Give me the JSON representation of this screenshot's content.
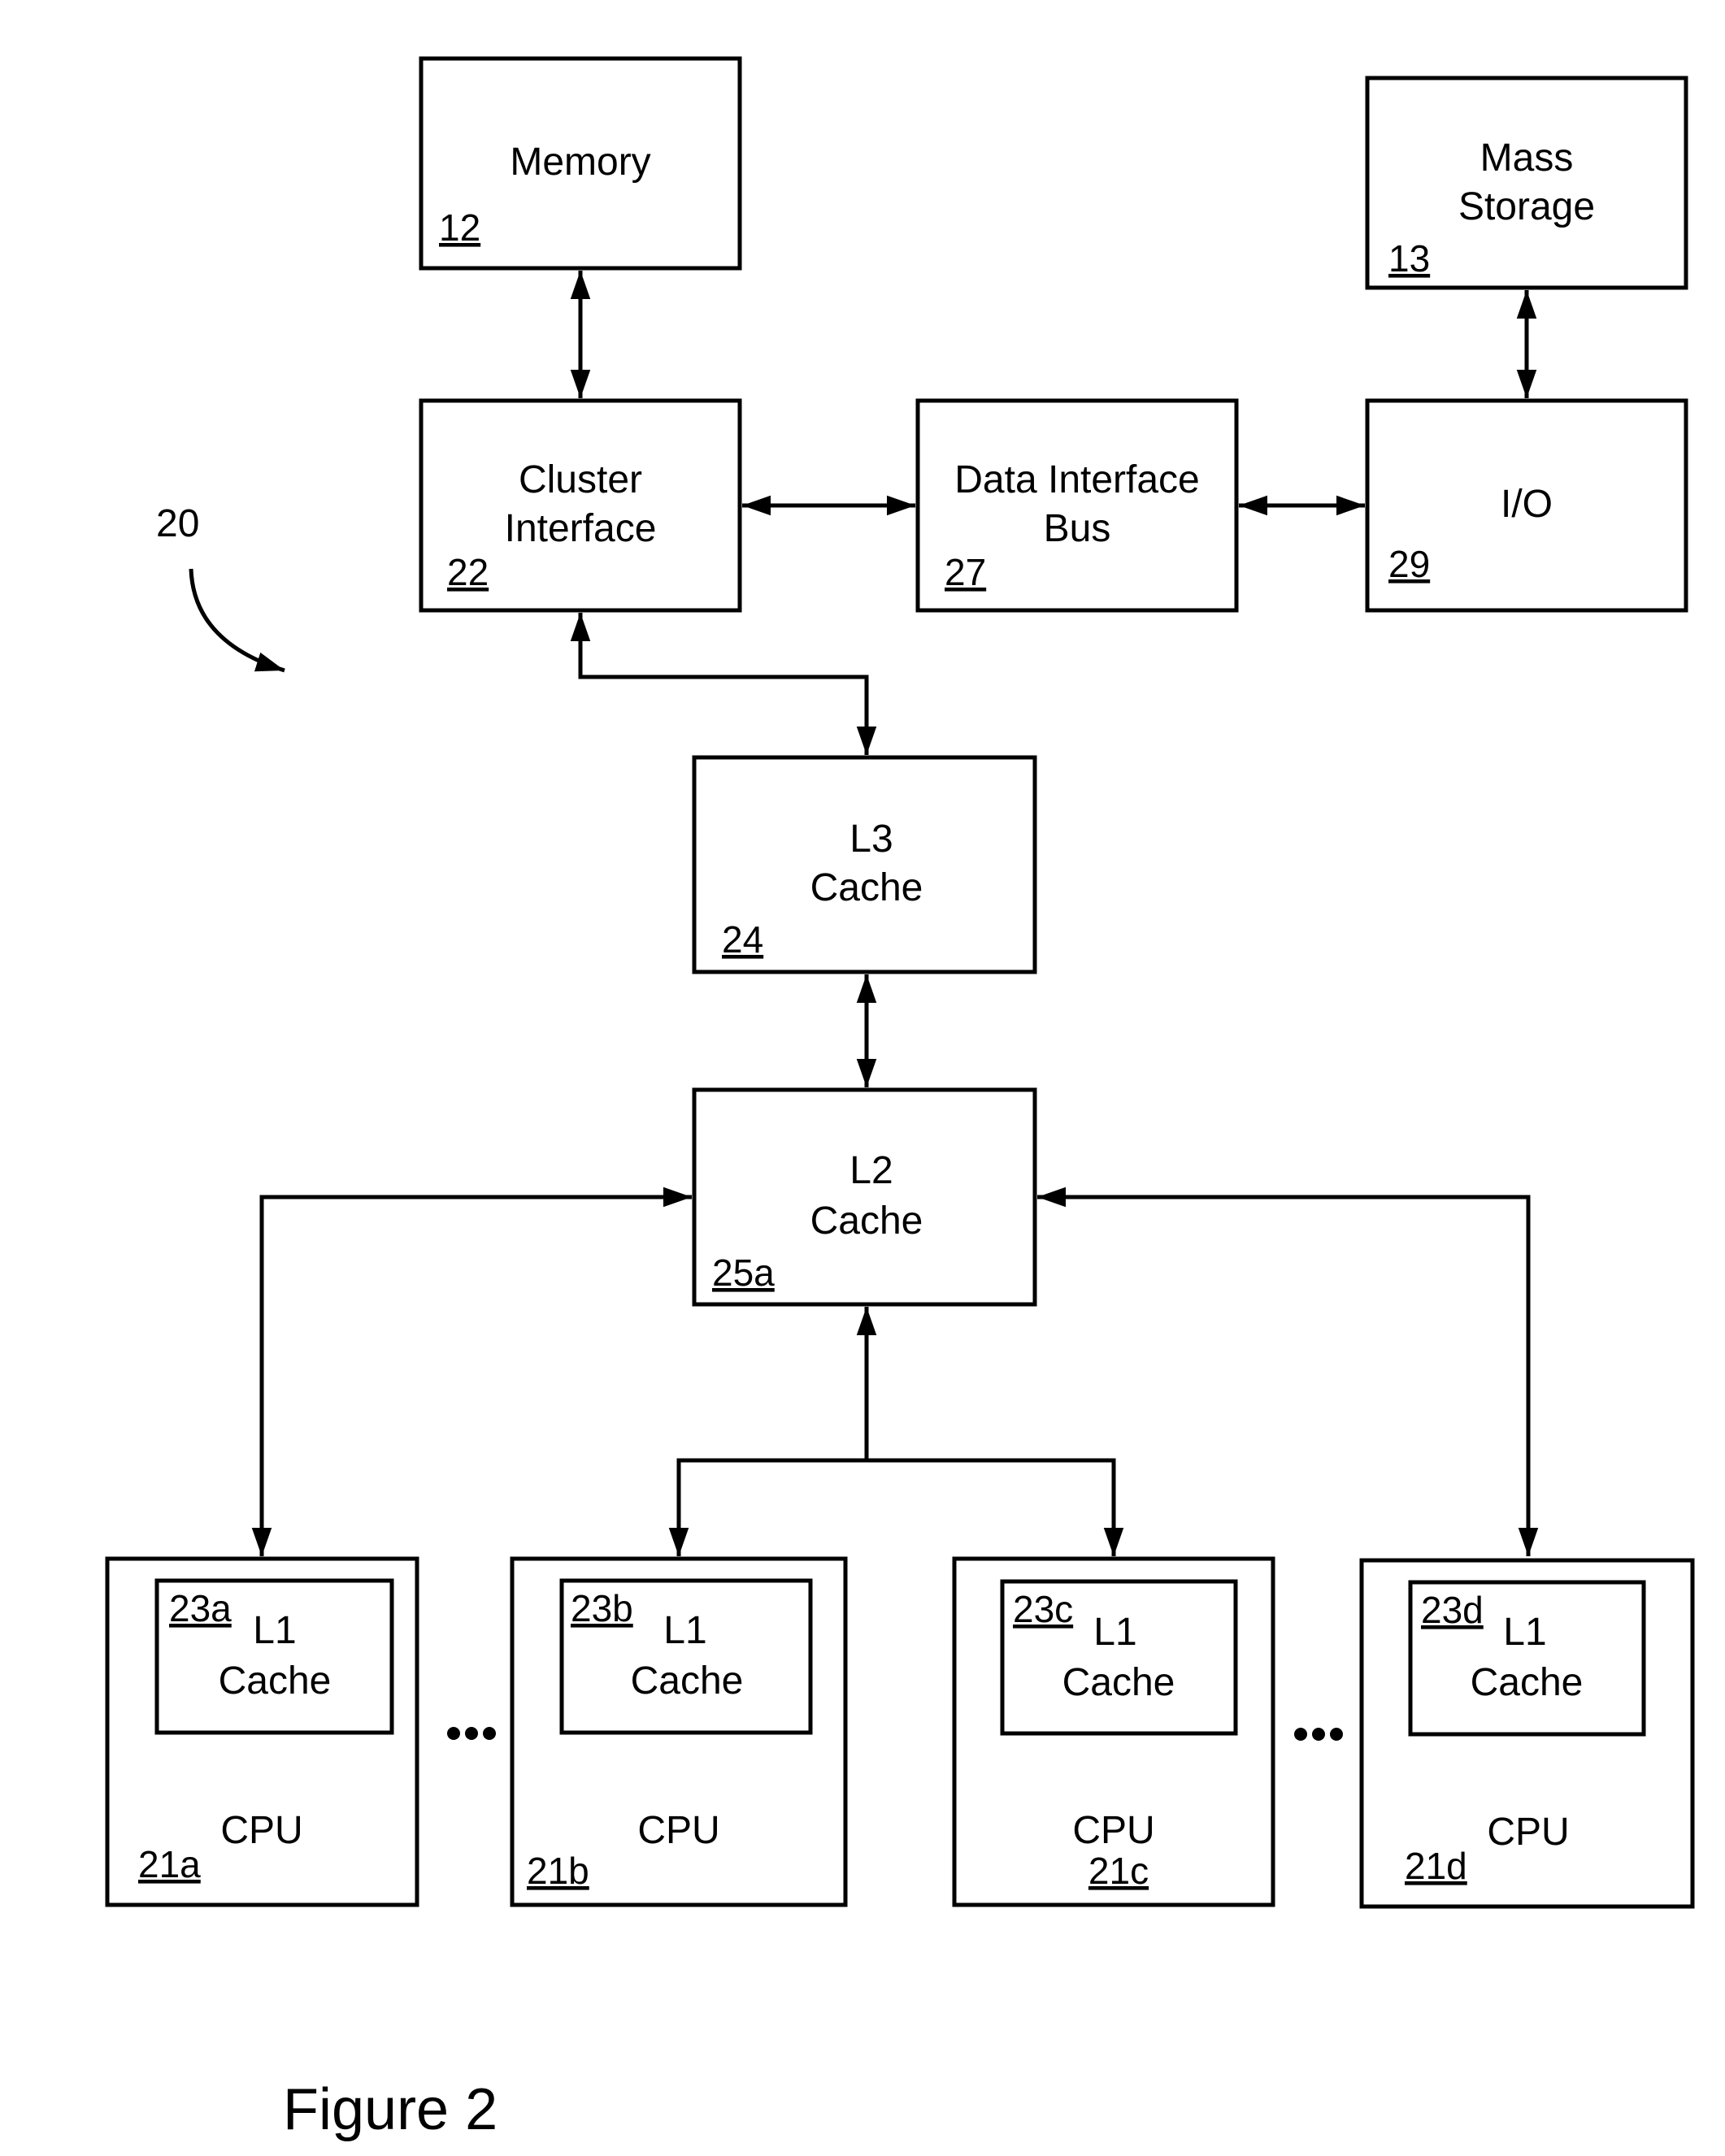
{
  "figure": {
    "caption": "Figure 2",
    "system_ref": "20"
  },
  "blocks": {
    "memory": {
      "lines": [
        "Memory"
      ],
      "ref": "12"
    },
    "mass_storage": {
      "lines": [
        "Mass",
        "Storage"
      ],
      "ref": "13"
    },
    "cluster_interface": {
      "lines": [
        "Cluster",
        "Interface"
      ],
      "ref": "22"
    },
    "data_interface_bus": {
      "lines": [
        "Data Interface",
        "Bus"
      ],
      "ref": "27"
    },
    "io": {
      "lines": [
        "I/O"
      ],
      "ref": "29"
    },
    "l3_cache": {
      "lines": [
        "L3",
        "Cache"
      ],
      "ref": "24"
    },
    "l2_cache": {
      "lines": [
        "L2",
        "Cache"
      ],
      "ref": "25a"
    }
  },
  "cpus": [
    {
      "label": "CPU",
      "ref": "21a",
      "l1": {
        "lines": [
          "L1",
          "Cache"
        ],
        "ref": "23a"
      }
    },
    {
      "label": "CPU",
      "ref": "21b",
      "l1": {
        "lines": [
          "L1",
          "Cache"
        ],
        "ref": "23b"
      }
    },
    {
      "label": "CPU",
      "ref": "21c",
      "l1": {
        "lines": [
          "L1",
          "Cache"
        ],
        "ref": "23c"
      }
    },
    {
      "label": "CPU",
      "ref": "21d",
      "l1": {
        "lines": [
          "L1",
          "Cache"
        ],
        "ref": "23d"
      }
    }
  ],
  "connections": [
    {
      "from": "memory",
      "to": "cluster_interface",
      "type": "bidirectional"
    },
    {
      "from": "mass_storage",
      "to": "io",
      "type": "bidirectional"
    },
    {
      "from": "cluster_interface",
      "to": "data_interface_bus",
      "type": "bidirectional"
    },
    {
      "from": "data_interface_bus",
      "to": "io",
      "type": "bidirectional"
    },
    {
      "from": "cluster_interface",
      "to": "l3_cache",
      "type": "bidirectional"
    },
    {
      "from": "l3_cache",
      "to": "l2_cache",
      "type": "bidirectional"
    },
    {
      "from": "l2_cache",
      "to": "cpu_21a",
      "type": "bidirectional"
    },
    {
      "from": "l2_cache",
      "to": "cpu_21b",
      "type": "bidirectional"
    },
    {
      "from": "l2_cache",
      "to": "cpu_21c",
      "type": "bidirectional"
    },
    {
      "from": "l2_cache",
      "to": "cpu_21d",
      "type": "bidirectional"
    }
  ],
  "ellipsis": "..."
}
